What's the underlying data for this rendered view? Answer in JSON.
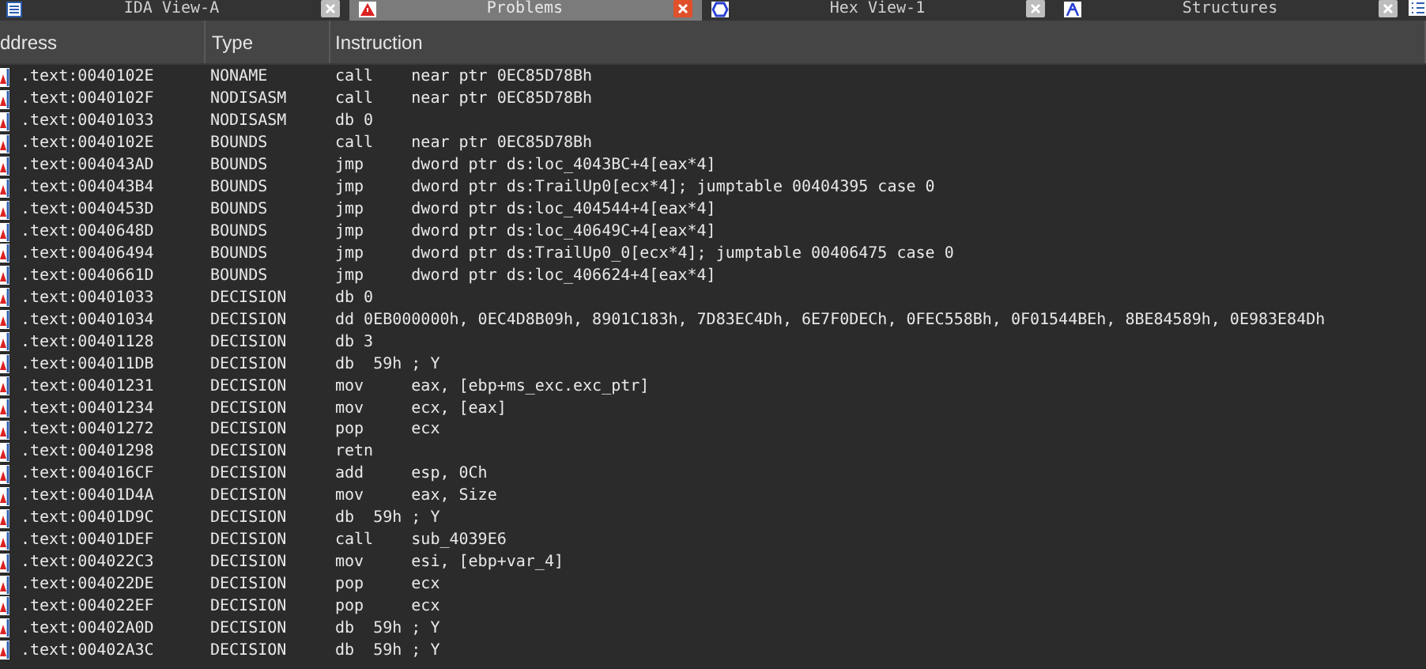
{
  "tabs": [
    {
      "label": "IDA View-A",
      "kind": "ida",
      "selected": false
    },
    {
      "label": "Problems",
      "kind": "problems",
      "selected": true
    },
    {
      "label": "Hex View-1",
      "kind": "hex",
      "selected": false
    },
    {
      "label": "Structures",
      "kind": "structures",
      "selected": false
    }
  ],
  "table": {
    "columns": [
      "ddress",
      "Type",
      "Instruction"
    ],
    "rows": [
      {
        "address": ".text:0040102E",
        "type": "NONAME",
        "instruction": "call    near ptr 0EC85D78Bh"
      },
      {
        "address": ".text:0040102F",
        "type": "NODISASM",
        "instruction": "call    near ptr 0EC85D78Bh"
      },
      {
        "address": ".text:00401033",
        "type": "NODISASM",
        "instruction": "db 0"
      },
      {
        "address": ".text:0040102E",
        "type": "BOUNDS",
        "instruction": "call    near ptr 0EC85D78Bh"
      },
      {
        "address": ".text:004043AD",
        "type": "BOUNDS",
        "instruction": "jmp     dword ptr ds:loc_4043BC+4[eax*4]"
      },
      {
        "address": ".text:004043B4",
        "type": "BOUNDS",
        "instruction": "jmp     dword ptr ds:TrailUp0[ecx*4]; jumptable 00404395 case 0"
      },
      {
        "address": ".text:0040453D",
        "type": "BOUNDS",
        "instruction": "jmp     dword ptr ds:loc_404544+4[eax*4]"
      },
      {
        "address": ".text:0040648D",
        "type": "BOUNDS",
        "instruction": "jmp     dword ptr ds:loc_40649C+4[eax*4]"
      },
      {
        "address": ".text:00406494",
        "type": "BOUNDS",
        "instruction": "jmp     dword ptr ds:TrailUp0_0[ecx*4]; jumptable 00406475 case 0"
      },
      {
        "address": ".text:0040661D",
        "type": "BOUNDS",
        "instruction": "jmp     dword ptr ds:loc_406624+4[eax*4]"
      },
      {
        "address": ".text:00401033",
        "type": "DECISION",
        "instruction": "db 0"
      },
      {
        "address": ".text:00401034",
        "type": "DECISION",
        "instruction": "dd 0EB000000h, 0EC4D8B09h, 8901C183h, 7D83EC4Dh, 6E7F0DECh, 0FEC558Bh, 0F01544BEh, 8BE84589h, 0E983E84Dh"
      },
      {
        "address": ".text:00401128",
        "type": "DECISION",
        "instruction": "db 3"
      },
      {
        "address": ".text:004011DB",
        "type": "DECISION",
        "instruction": "db  59h ; Y"
      },
      {
        "address": ".text:00401231",
        "type": "DECISION",
        "instruction": "mov     eax, [ebp+ms_exc.exc_ptr]"
      },
      {
        "address": ".text:00401234",
        "type": "DECISION",
        "instruction": "mov     ecx, [eax]"
      },
      {
        "address": ".text:00401272",
        "type": "DECISION",
        "instruction": "pop     ecx"
      },
      {
        "address": ".text:00401298",
        "type": "DECISION",
        "instruction": "retn"
      },
      {
        "address": ".text:004016CF",
        "type": "DECISION",
        "instruction": "add     esp, 0Ch"
      },
      {
        "address": ".text:00401D4A",
        "type": "DECISION",
        "instruction": "mov     eax, Size"
      },
      {
        "address": ".text:00401D9C",
        "type": "DECISION",
        "instruction": "db  59h ; Y"
      },
      {
        "address": ".text:00401DEF",
        "type": "DECISION",
        "instruction": "call    sub_4039E6"
      },
      {
        "address": ".text:004022C3",
        "type": "DECISION",
        "instruction": "mov     esi, [ebp+var_4]"
      },
      {
        "address": ".text:004022DE",
        "type": "DECISION",
        "instruction": "pop     ecx"
      },
      {
        "address": ".text:004022EF",
        "type": "DECISION",
        "instruction": "pop     ecx"
      },
      {
        "address": ".text:00402A0D",
        "type": "DECISION",
        "instruction": "db  59h ; Y"
      },
      {
        "address": ".text:00402A3C",
        "type": "DECISION",
        "instruction": "db  59h ; Y"
      }
    ]
  }
}
